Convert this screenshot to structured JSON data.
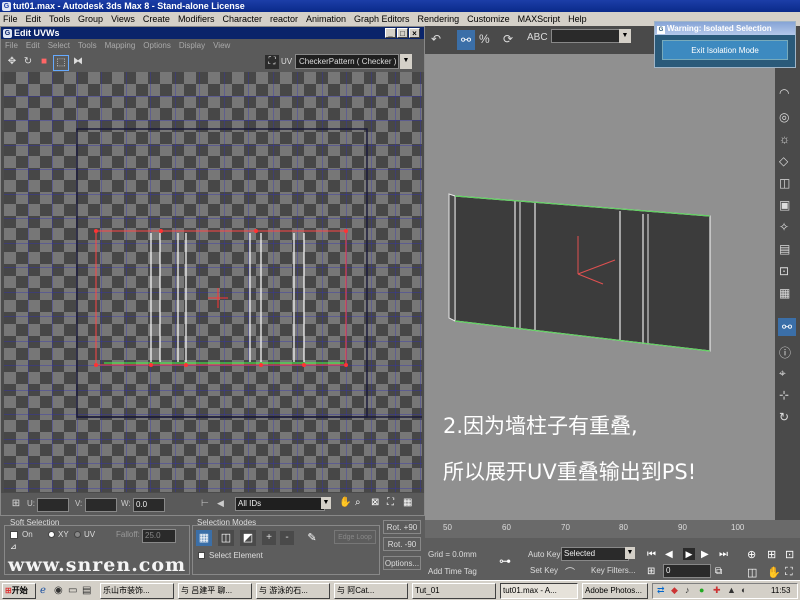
{
  "app": {
    "title": "tut01.max - Autodesk 3ds Max 8 - Stand-alone License"
  },
  "menu": [
    "File",
    "Edit",
    "Tools",
    "Group",
    "Views",
    "Create",
    "Modifiers",
    "Character",
    "reactor",
    "Animation",
    "Graph Editors",
    "Rendering",
    "Customize",
    "MAXScript",
    "Help"
  ],
  "uvw": {
    "title": "Edit UVWs",
    "menu": [
      "File",
      "Edit",
      "Select",
      "Tools",
      "Mapping",
      "Options",
      "Display",
      "View"
    ],
    "map_select": "CheckerPattern  ( Checker )",
    "uv_label": "UV",
    "u_label": "U:",
    "v_label": "V:",
    "w_label": "W:",
    "w_value": "0.0",
    "ids_select": "All IDs"
  },
  "softsel": {
    "title": "Soft Selection",
    "on_label": "On",
    "xy_label": "XY",
    "uv_label": "UV",
    "falloff_label": "Falloff:",
    "falloff_value": "25.0"
  },
  "selmodes": {
    "title": "Selection Modes",
    "select_element": "Select Element",
    "edge_loop": "Edge Loop"
  },
  "rotate": {
    "rot_plus": "Rot. +90",
    "rot_minus": "Rot. -90",
    "options": "Options..."
  },
  "watermark": "www.snren.com",
  "warning": {
    "title": "Warning: Isolated Selection",
    "button": "Exit Isolation Mode"
  },
  "caption": {
    "line1": "2.因为墙柱子有重叠,",
    "line2": "所以展开UV重叠输出到PS!"
  },
  "timeline": {
    "ticks": [
      "50",
      "60",
      "70",
      "80",
      "90",
      "100"
    ],
    "grid": "Grid = 0.0mm",
    "add_time_tag": "Add Time Tag",
    "auto_key": "Auto Key",
    "set_key": "Set Key",
    "selected": "Selected",
    "key_filters": "Key Filters...",
    "frame": "0"
  },
  "taskbar": {
    "start": "开始",
    "items": [
      "乐山市装饰...",
      "与 吕建平 聊...",
      "与 游泳的石...",
      "与 阿Cat...",
      "Tut_01",
      "tut01.max - A...",
      "Adobe Photos..."
    ],
    "time": "11:53"
  }
}
